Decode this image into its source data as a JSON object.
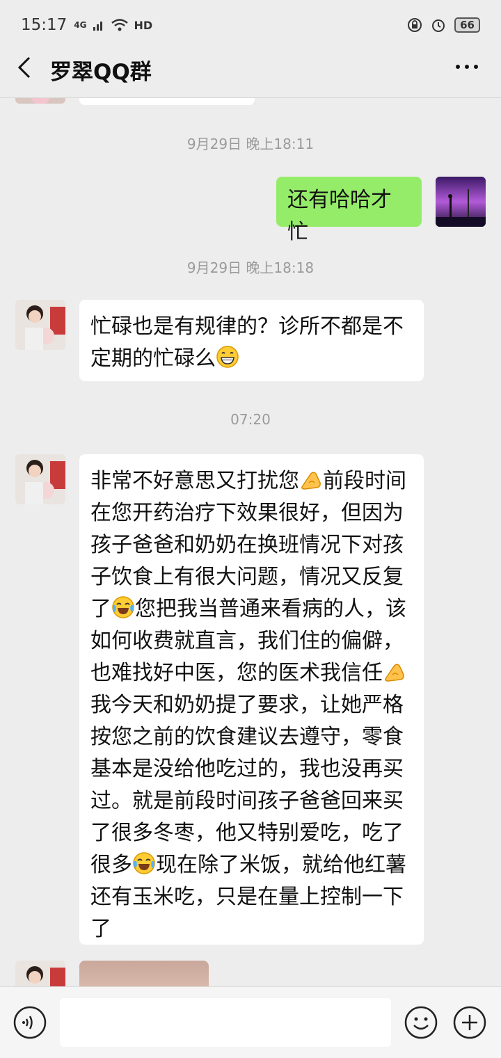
{
  "status_bar": {
    "time": "15:17",
    "network": "4G",
    "hd": "HD",
    "battery": "66"
  },
  "header": {
    "title": "罗翠QQ群"
  },
  "messages": {
    "ts1": "9月29日 晚上18:11",
    "msg1": "还有哈哈才忙",
    "ts2": "9月29日 晚上18:18",
    "msg2": "忙碌也是有规律的？诊所不都是不定期的忙碌么",
    "ts3": "07:20",
    "msg3": {
      "p1": "非常不好意思又打扰您",
      "p2": "前段时间在您开药治疗下效果很好，但因为孩子爸爸和奶奶在换班情况下对孩子饮食上有很大问题，情况又反复了",
      "p3": "您把我当普通来看病的人，该如何收费就直言，我们住的偏僻，也难找好中医，您的医术我信任",
      "p4": "我今天和奶奶提了要求，让她严格按您之前的饮食建议去遵守，零食基本是没给他吃过的，我也没再买过。就是前段时间孩子爸爸回来买了很多冬枣，他又特别爱吃，吃了很多",
      "p5": "现在除了米饭，就给他红薯还有玉米吃，只是在量上控制一下了"
    }
  },
  "icons": {
    "back": "chevron-left-icon",
    "more": "more-dots-icon",
    "voice": "voice-icon",
    "emoji": "emoji-face-icon",
    "plus": "plus-icon",
    "grin": "grinning-emoji",
    "ok_hand": "ok-hand-emoji",
    "laugh_cry": "laughing-crying-emoji"
  },
  "colors": {
    "my_bubble": "#95ec69",
    "other_bubble": "#ffffff",
    "background": "#ededed"
  }
}
